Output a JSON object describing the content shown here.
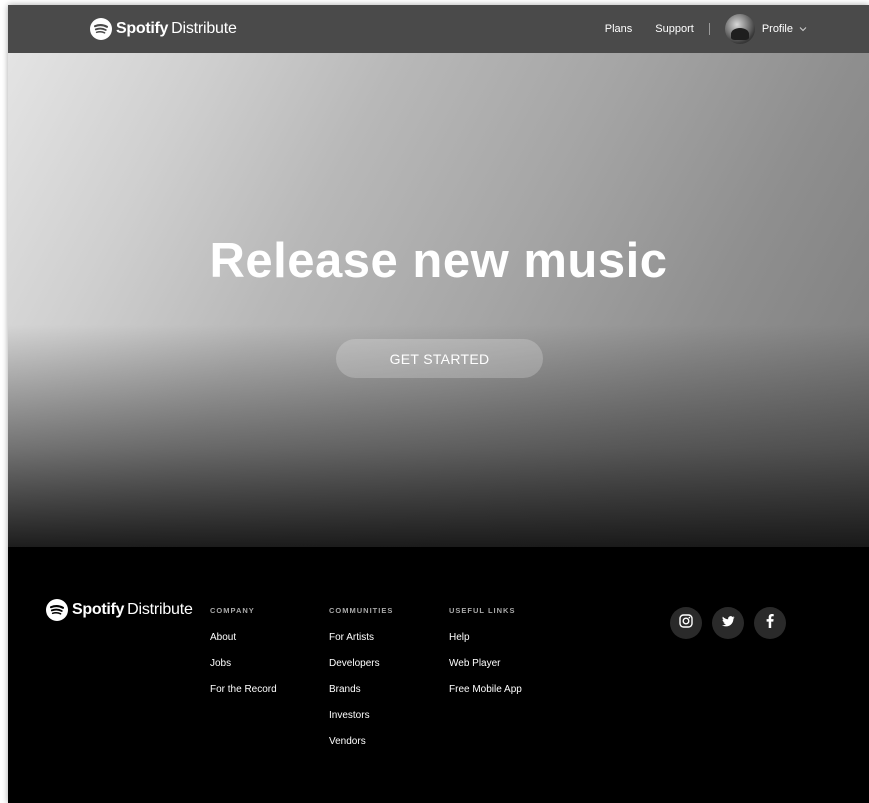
{
  "topnav": {
    "brand": {
      "name": "Spotify",
      "product": "Distribute",
      "icon": "spotify-logo-icon"
    },
    "links": [
      {
        "label": "Plans"
      },
      {
        "label": "Support"
      }
    ],
    "profile": {
      "label": "Profile",
      "icon": "chevron-down-icon"
    }
  },
  "hero": {
    "title": "Release new music",
    "cta_label": "GET STARTED"
  },
  "footer": {
    "brand": {
      "name": "Spotify",
      "product": "Distribute"
    },
    "columns": [
      {
        "heading": "COMPANY",
        "links": [
          "About",
          "Jobs",
          "For the Record"
        ]
      },
      {
        "heading": "COMMUNITIES",
        "links": [
          "For Artists",
          "Developers",
          "Brands",
          "Investors",
          "Vendors"
        ]
      },
      {
        "heading": "USEFUL LINKS",
        "links": [
          "Help",
          "Web Player",
          "Free Mobile App"
        ]
      }
    ],
    "social": [
      {
        "icon": "instagram-icon"
      },
      {
        "icon": "twitter-icon"
      },
      {
        "icon": "facebook-icon"
      }
    ]
  },
  "colors": {
    "nav_bg": "#4a4a4a",
    "footer_bg": "#000000",
    "social_bg": "#2a2a2a",
    "text": "#ffffff"
  }
}
